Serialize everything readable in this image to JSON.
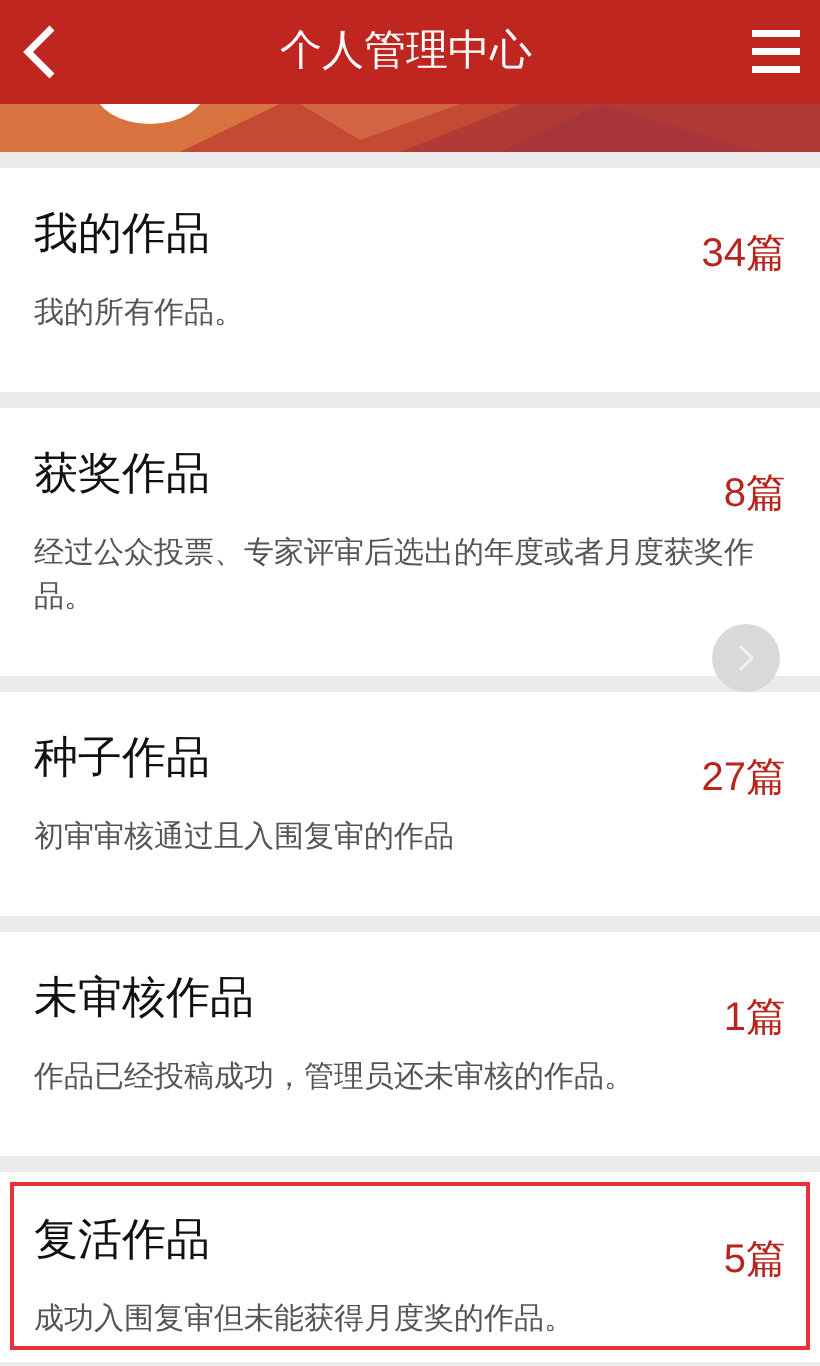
{
  "header": {
    "title": "个人管理中心"
  },
  "works": [
    {
      "title": "我的作品",
      "count": "34篇",
      "description": "我的所有作品。",
      "selected": false
    },
    {
      "title": "获奖作品",
      "count": "8篇",
      "description": "经过公众投票、专家评审后选出的年度或者月度获奖作品。",
      "selected": false
    },
    {
      "title": "种子作品",
      "count": "27篇",
      "description": "初审审核通过且入围复审的作品",
      "selected": false
    },
    {
      "title": "未审核作品",
      "count": "1篇",
      "description": "作品已经投稿成功，管理员还未审核的作品。",
      "selected": false
    },
    {
      "title": "复活作品",
      "count": "5篇",
      "description": "成功入围复审但未能获得月度奖的作品。",
      "selected": true
    }
  ]
}
